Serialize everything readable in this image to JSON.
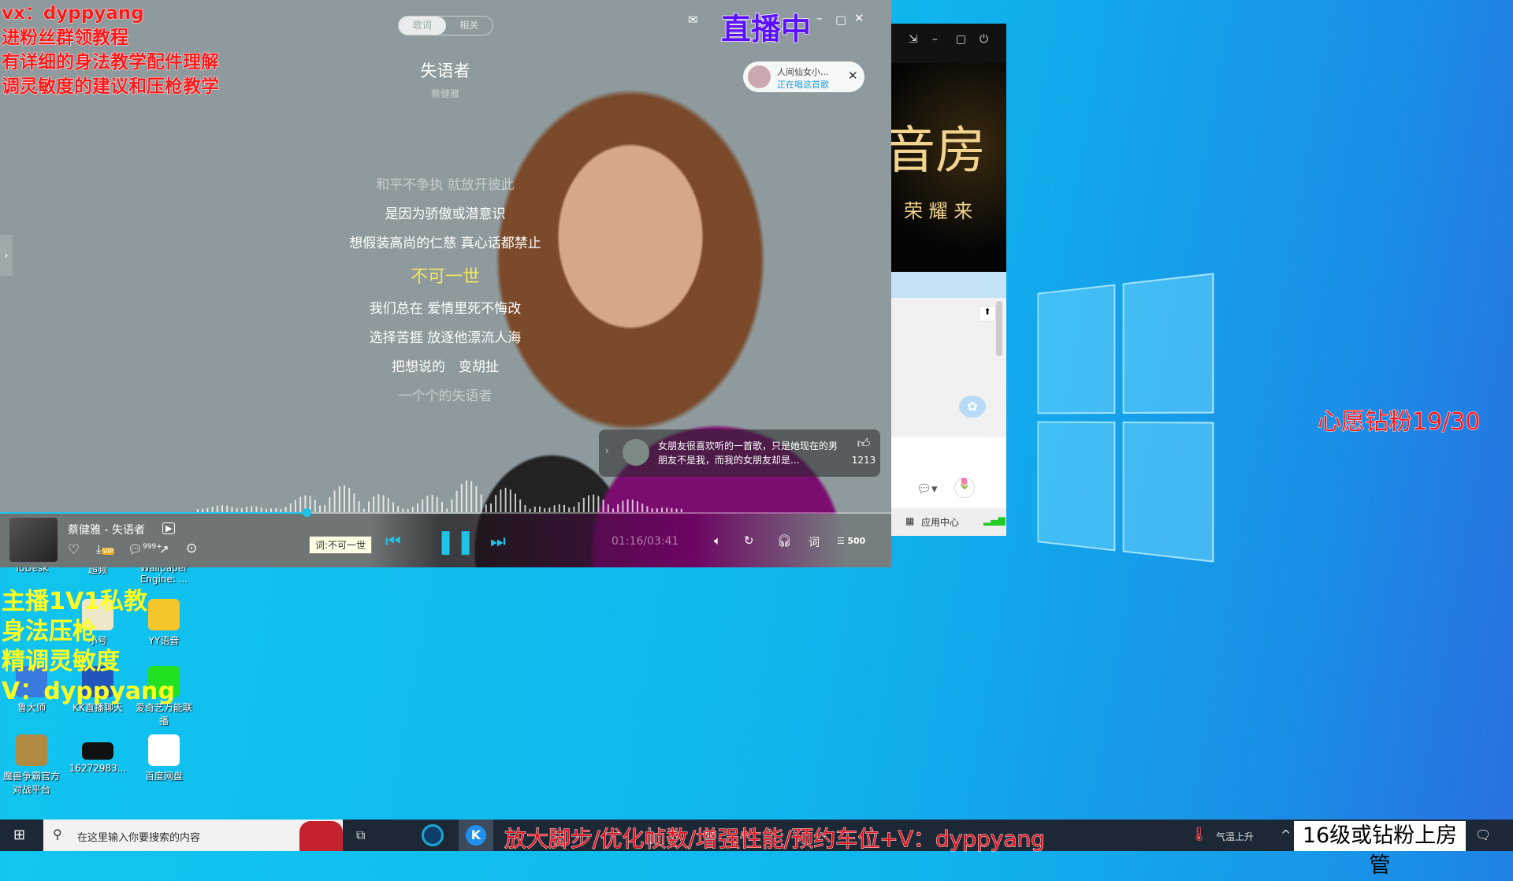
{
  "overlays": {
    "top_left": [
      "vx：dyppyang",
      "进粉丝群领教程",
      "有详细的身法教学配件理解",
      "调灵敏度的建议和压枪教学"
    ],
    "live": "直播中",
    "right": "心愿钻粉19/30",
    "yellow": [
      "主播1V1私教",
      "身法压枪",
      "精调灵敏度",
      "V：dyppyang"
    ],
    "taskbar_banner": "放大脚步/优化帧数/增强性能/预约车位+V：dyppyang",
    "taskbar_box": "16级或钻粉上房管"
  },
  "player": {
    "tabs": [
      "歌词",
      "相关"
    ],
    "active_tab": 0,
    "song_title": "失语者",
    "artist": "蔡健雅",
    "lyrics": [
      "和平不争执 就放开彼此",
      "是因为骄傲或潜意识",
      "想假装高尚的仁慈 真心话都禁止",
      "不可一世",
      "我们总在 爱情里死不悔改",
      "选择苦捱 放逐他漂流人海",
      "把想说的　变胡扯",
      "一个个的失语者"
    ],
    "current_lyric_index": 3,
    "singer_pill": {
      "name": "人间仙女小...",
      "status": "正在唱这首歌"
    },
    "comment": {
      "text": "女朋友很喜欢听的一首歌，只是她现在的男朋友不是我，而我的女朋友却是...",
      "likes": "1213"
    },
    "now_playing": "蔡健雅 - 失语者",
    "comment_count": "999+",
    "vip": "VIP",
    "tooltip": "词:不可一世",
    "time": "01:16/03:41",
    "progress": 0.344,
    "lyric_btn": "词",
    "playlist_count": "500"
  },
  "side_window": {
    "banner_big": "音房",
    "banner_small": "荣 耀 来",
    "app_center": "应用中心"
  },
  "desktop": {
    "icons": [
      "ToDesk",
      "超频",
      "Wallpaper Engine: ...",
      "",
      "小号",
      "YY语音",
      "鲁大师",
      "KK直播聊天",
      "爱奇艺万能联播",
      "魔兽争霸官方对战平台",
      "16272983...",
      "百度网盘"
    ]
  },
  "taskbar": {
    "search_placeholder": "在这里输入你要搜索的内容",
    "weather": "气温上升"
  },
  "colors": {
    "accent": "#1fc3e8",
    "lyric_highlight": "#f7e65a",
    "overlay_red": "#ff1818",
    "overlay_yellow": "#ffff20"
  }
}
